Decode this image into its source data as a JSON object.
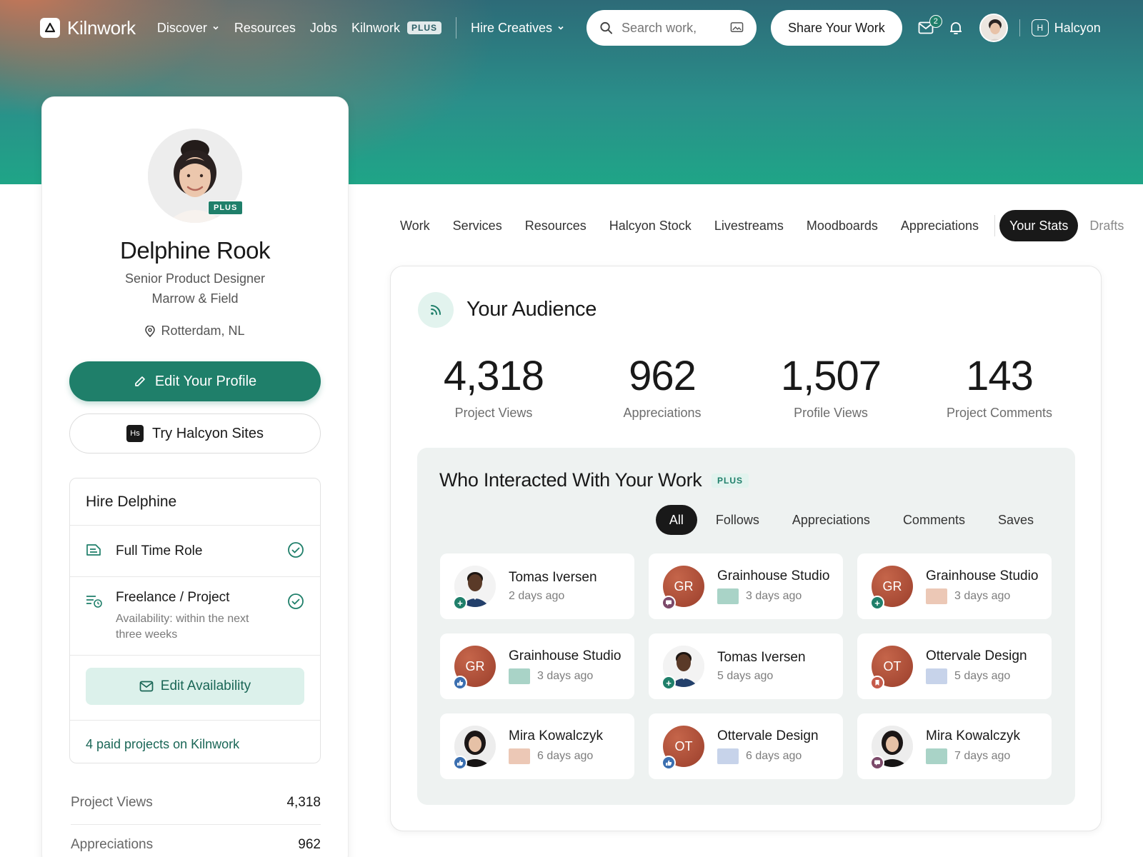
{
  "nav": {
    "brand": "Kilnwork",
    "links": {
      "discover": "Discover",
      "resources": "Resources",
      "jobs": "Jobs",
      "kilnwork": "Kilnwork",
      "kilnwork_badge": "PLUS",
      "hire": "Hire Creatives"
    },
    "search_placeholder": "Search work,",
    "share_button": "Share Your Work",
    "message_count": "2",
    "org_initial": "H",
    "org_name": "Halcyon"
  },
  "profile": {
    "badge": "PLUS",
    "name": "Delphine Rook",
    "role": "Senior Product Designer",
    "company": "Marrow & Field",
    "location": "Rotterdam, NL",
    "edit_button": "Edit Your Profile",
    "sites_mark": "Hs",
    "sites_button": "Try Halcyon Sites"
  },
  "hire": {
    "title": "Hire Delphine",
    "full_time": "Full Time Role",
    "freelance": "Freelance / Project",
    "freelance_sub": "Availability: within the next three weeks",
    "availability_button": "Edit Availability",
    "paid_projects": "4 paid projects on Kilnwork"
  },
  "side_stats": [
    {
      "label": "Project Views",
      "value": "4,318"
    },
    {
      "label": "Appreciations",
      "value": "962"
    }
  ],
  "tabs": [
    "Work",
    "Services",
    "Resources",
    "Halcyon Stock",
    "Livestreams",
    "Moodboards",
    "Appreciations",
    "Your Stats",
    "Drafts"
  ],
  "active_tab": "Your Stats",
  "audience": {
    "title": "Your Audience",
    "stats": [
      {
        "value": "4,318",
        "label": "Project Views"
      },
      {
        "value": "962",
        "label": "Appreciations"
      },
      {
        "value": "1,507",
        "label": "Profile Views"
      },
      {
        "value": "143",
        "label": "Project Comments"
      }
    ]
  },
  "interactions": {
    "title": "Who Interacted With Your Work",
    "badge": "PLUS",
    "filters": [
      "All",
      "Follows",
      "Appreciations",
      "Comments",
      "Saves"
    ],
    "active_filter": "All",
    "items": [
      {
        "name": "Tomas Iversen",
        "time": "2 days ago",
        "avatar": "person-male",
        "initials": "",
        "action": "follow",
        "thumb": ""
      },
      {
        "name": "Grainhouse Studio",
        "time": "3 days ago",
        "avatar": "initials",
        "initials": "GR",
        "action": "comment",
        "thumb": "#a9d3c7"
      },
      {
        "name": "Grainhouse Studio",
        "time": "3 days ago",
        "avatar": "initials",
        "initials": "GR",
        "action": "follow",
        "thumb": "#ecc8b6"
      },
      {
        "name": "Grainhouse Studio",
        "time": "3 days ago",
        "avatar": "initials",
        "initials": "GR",
        "action": "appreciate",
        "thumb": "#a9d3c7"
      },
      {
        "name": "Tomas Iversen",
        "time": "5 days ago",
        "avatar": "person-male",
        "initials": "",
        "action": "follow",
        "thumb": ""
      },
      {
        "name": "Ottervale Design",
        "time": "5 days ago",
        "avatar": "initials",
        "initials": "OT",
        "action": "save",
        "thumb": "#c7d3ea"
      },
      {
        "name": "Mira Kowalczyk",
        "time": "6 days ago",
        "avatar": "person-female",
        "initials": "",
        "action": "appreciate",
        "thumb": "#ecc8b6"
      },
      {
        "name": "Ottervale Design",
        "time": "6 days ago",
        "avatar": "initials",
        "initials": "OT",
        "action": "appreciate",
        "thumb": "#c7d3ea"
      },
      {
        "name": "Mira Kowalczyk",
        "time": "7 days ago",
        "avatar": "person-female",
        "initials": "",
        "action": "comment",
        "thumb": "#a9d3c7"
      }
    ]
  },
  "colors": {
    "accent": "#1f7f6a",
    "accent_light": "#dcf1eb",
    "dark": "#191919"
  }
}
